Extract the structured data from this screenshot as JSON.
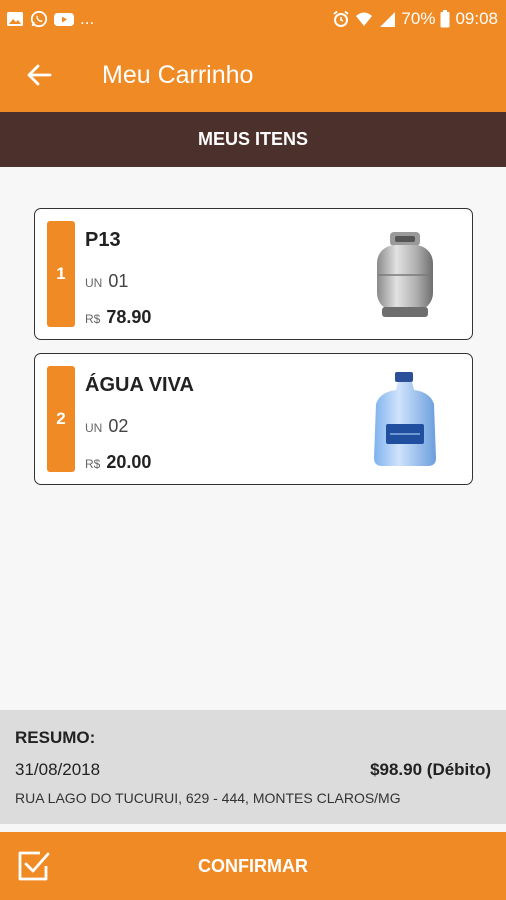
{
  "status_bar": {
    "notifications_more": "...",
    "battery": "70%",
    "time": "09:08"
  },
  "app_bar": {
    "title": "Meu Carrinho"
  },
  "section": {
    "title": "MEUS ITENS"
  },
  "items": [
    {
      "index": "1",
      "name": "P13",
      "qty_label": "UN",
      "qty": "01",
      "currency_label": "R$",
      "price": "78.90",
      "icon": "gas-cylinder"
    },
    {
      "index": "2",
      "name": "ÁGUA VIVA",
      "qty_label": "UN",
      "qty": "02",
      "currency_label": "R$",
      "price": "20.00",
      "icon": "water-jug"
    }
  ],
  "summary": {
    "title": "RESUMO:",
    "date": "31/08/2018",
    "total": "$98.90 (Débito)",
    "address": "RUA LAGO DO TUCURUI, 629 - 444, MONTES CLAROS/MG"
  },
  "confirm": {
    "label": "CONFIRMAR"
  },
  "colors": {
    "primary": "#f08a24",
    "section_bar": "#4b302b",
    "summary_bg": "#dcdcdc"
  }
}
